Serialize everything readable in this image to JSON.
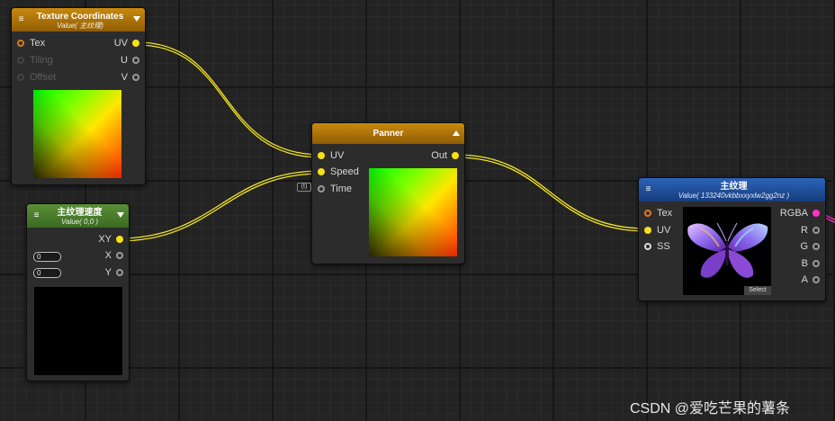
{
  "nodes": {
    "texture_coordinates": {
      "title": "Texture Coordinates",
      "subtitle": "Value( 主纹理)",
      "inputs": [
        {
          "label": "Tex"
        },
        {
          "label": "Tiling"
        },
        {
          "label": "Offset"
        }
      ],
      "outputs": [
        {
          "label": "UV"
        },
        {
          "label": "U"
        },
        {
          "label": "V"
        }
      ]
    },
    "speed_vector": {
      "title": "主纹理速度",
      "subtitle": "Value( 0,0 )",
      "outputs": [
        {
          "label": "XY"
        },
        {
          "label": "X"
        },
        {
          "label": "Y"
        }
      ],
      "fields": [
        {
          "value": "0"
        },
        {
          "value": "0"
        }
      ]
    },
    "panner": {
      "title": "Panner",
      "inputs": [
        {
          "label": "UV"
        },
        {
          "label": "Speed"
        },
        {
          "label": "Time"
        }
      ],
      "outputs": [
        {
          "label": "Out"
        }
      ],
      "time_tag": "(t)"
    },
    "texture_sample": {
      "title": "主纹理",
      "subtitle": "Value( 133240vkbbxxyxlw2gg2nz )",
      "inputs": [
        {
          "label": "Tex"
        },
        {
          "label": "UV"
        },
        {
          "label": "SS"
        }
      ],
      "outputs": [
        {
          "label": "RGBA"
        },
        {
          "label": "R"
        },
        {
          "label": "G"
        },
        {
          "label": "B"
        },
        {
          "label": "A"
        }
      ],
      "select_label": "Select"
    }
  },
  "watermark": "CSDN @爱吃芒果的薯条",
  "colors": {
    "wire": "#f3e51f",
    "header_orange": "#c8890e",
    "header_green": "#5a8f36",
    "header_blue": "#2c63b9",
    "port_yellow": "#f5e01a",
    "port_magenta": "#ff33cc"
  },
  "icons": {
    "menu": "hamburger-menu-icon",
    "collapse": "triangle-icon"
  }
}
